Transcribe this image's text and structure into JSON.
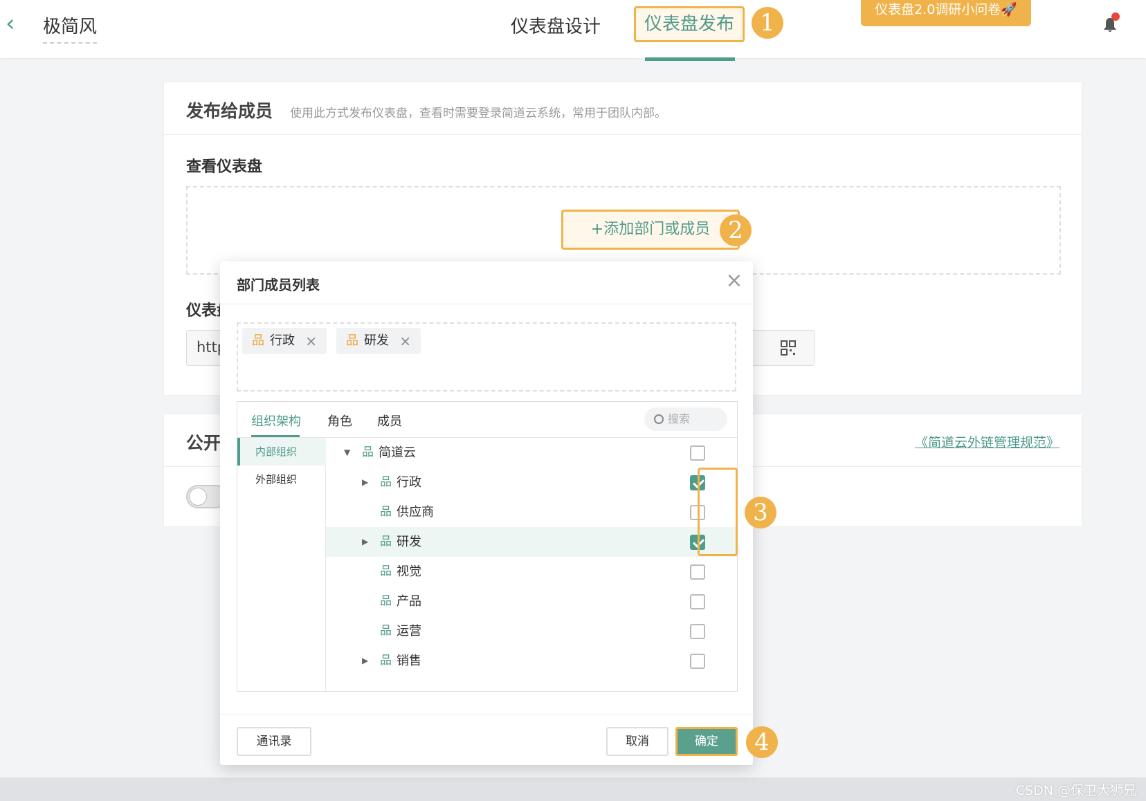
{
  "topbar": {
    "app_title": "极简风",
    "nav_design": "仪表盘设计",
    "nav_publish": "仪表盘发布",
    "survey_label": "仪表盘2.0调研小问卷🚀"
  },
  "badges": [
    "1",
    "2",
    "3",
    "4"
  ],
  "publish_members": {
    "title": "发布给成员",
    "description": "使用此方式发布仪表盘，查看时需要登录简道云系统，常用于团队内部。",
    "view_title": "查看仪表盘",
    "add_button": "+添加部门或成员",
    "dashboard_label": "仪表盘",
    "link_value": "http"
  },
  "public_section": {
    "title": "公开",
    "rules_link": "《简道云外链管理规范》",
    "toggle_label": "关"
  },
  "modal": {
    "title": "部门成员列表",
    "selected": [
      {
        "label": "行政"
      },
      {
        "label": "研发"
      }
    ],
    "tabs": [
      "组织架构",
      "角色",
      "成员"
    ],
    "search_placeholder": "搜索",
    "sidebar": [
      "内部组织",
      "外部组织"
    ],
    "tree": [
      {
        "label": "简道云",
        "expand": "down",
        "level": 0,
        "checked": false
      },
      {
        "label": "行政",
        "expand": "right",
        "level": 1,
        "checked": true
      },
      {
        "label": "供应商",
        "expand": "",
        "level": 1,
        "checked": false
      },
      {
        "label": "研发",
        "expand": "right",
        "level": 1,
        "checked": true,
        "highlight": true
      },
      {
        "label": "视觉",
        "expand": "",
        "level": 1,
        "checked": false
      },
      {
        "label": "产品",
        "expand": "",
        "level": 1,
        "checked": false
      },
      {
        "label": "运营",
        "expand": "",
        "level": 1,
        "checked": false
      },
      {
        "label": "销售",
        "expand": "right",
        "level": 1,
        "checked": false
      }
    ],
    "buttons": {
      "contacts": "通讯录",
      "cancel": "取消",
      "ok": "确定"
    }
  },
  "watermark": "CSDN @保卫大狮兄",
  "colors": {
    "accent": "#4f9b8c",
    "highlight": "#f0b34b",
    "danger": "#e8453c"
  }
}
